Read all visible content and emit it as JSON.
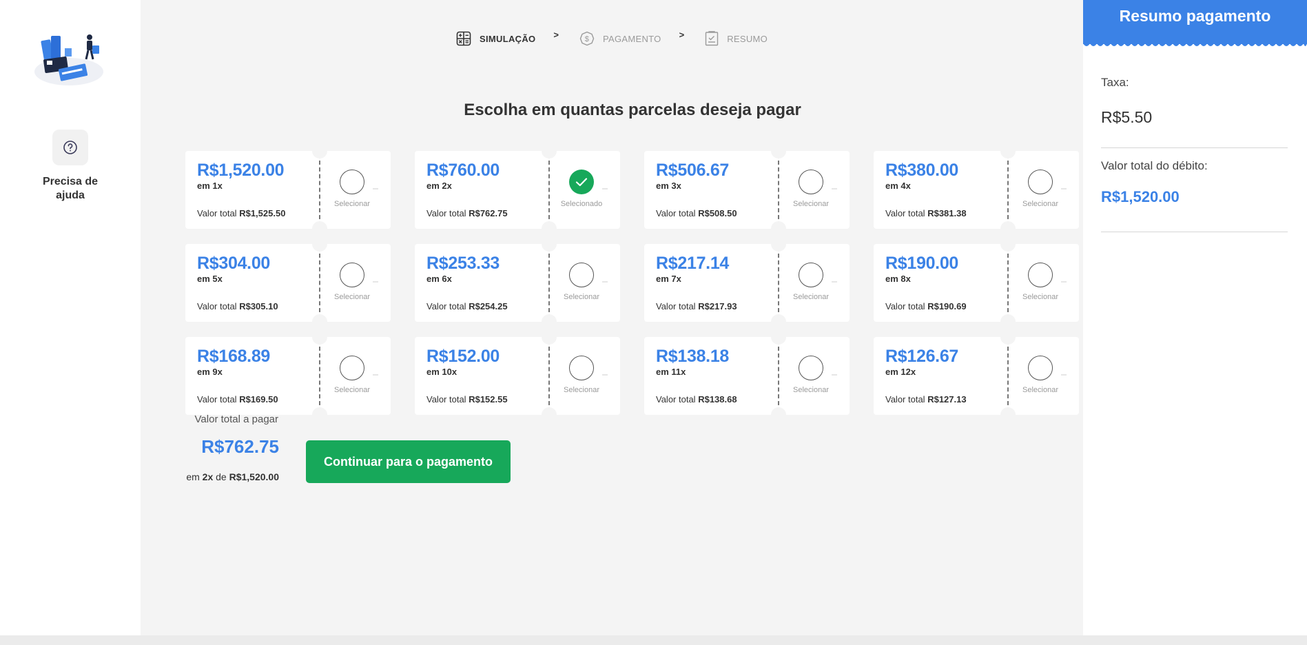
{
  "sidebar": {
    "help_label": "Precisa de ajuda"
  },
  "steps": [
    {
      "label": "SIMULAÇÃO",
      "active": true,
      "icon": "calculator-icon"
    },
    {
      "label": "PAGAMENTO",
      "active": false,
      "icon": "dollar-coin-icon"
    },
    {
      "label": "RESUMO",
      "active": false,
      "icon": "receipt-icon"
    }
  ],
  "step_separator": ">",
  "heading": "Escolha em quantas parcelas deseja pagar",
  "options": [
    {
      "amount": "R$1,520.00",
      "times": "em 1x",
      "total_label": "Valor total",
      "total": "R$1,525.50",
      "status": "Selecionar",
      "selected": false
    },
    {
      "amount": "R$760.00",
      "times": "em 2x",
      "total_label": "Valor total",
      "total": "R$762.75",
      "status": "Selecionado",
      "selected": true
    },
    {
      "amount": "R$506.67",
      "times": "em 3x",
      "total_label": "Valor total",
      "total": "R$508.50",
      "status": "Selecionar",
      "selected": false
    },
    {
      "amount": "R$380.00",
      "times": "em 4x",
      "total_label": "Valor total",
      "total": "R$381.38",
      "status": "Selecionar",
      "selected": false
    },
    {
      "amount": "R$304.00",
      "times": "em 5x",
      "total_label": "Valor total",
      "total": "R$305.10",
      "status": "Selecionar",
      "selected": false
    },
    {
      "amount": "R$253.33",
      "times": "em 6x",
      "total_label": "Valor total",
      "total": "R$254.25",
      "status": "Selecionar",
      "selected": false
    },
    {
      "amount": "R$217.14",
      "times": "em 7x",
      "total_label": "Valor total",
      "total": "R$217.93",
      "status": "Selecionar",
      "selected": false
    },
    {
      "amount": "R$190.00",
      "times": "em 8x",
      "total_label": "Valor total",
      "total": "R$190.69",
      "status": "Selecionar",
      "selected": false
    },
    {
      "amount": "R$168.89",
      "times": "em 9x",
      "total_label": "Valor total",
      "total": "R$169.50",
      "status": "Selecionar",
      "selected": false
    },
    {
      "amount": "R$152.00",
      "times": "em 10x",
      "total_label": "Valor total",
      "total": "R$152.55",
      "status": "Selecionar",
      "selected": false
    },
    {
      "amount": "R$138.18",
      "times": "em 11x",
      "total_label": "Valor total",
      "total": "R$138.68",
      "status": "Selecionar",
      "selected": false
    },
    {
      "amount": "R$126.67",
      "times": "em 12x",
      "total_label": "Valor total",
      "total": "R$127.13",
      "status": "Selecionar",
      "selected": false
    }
  ],
  "total_to_pay": {
    "label": "Valor total a pagar",
    "value": "R$762.75",
    "prefix": "em",
    "times": "2x",
    "of": "de",
    "base": "R$1,520.00"
  },
  "continue_button": "Continuar para o pagamento",
  "summary_panel": {
    "title": "Resumo pagamento",
    "fee_label": "Taxa:",
    "fee_value": "R$5.50",
    "debit_label": "Valor total do débito:",
    "debit_value": "R$1,520.00"
  },
  "colors": {
    "accent_blue": "#3b82e6",
    "success_green": "#17a85a"
  }
}
